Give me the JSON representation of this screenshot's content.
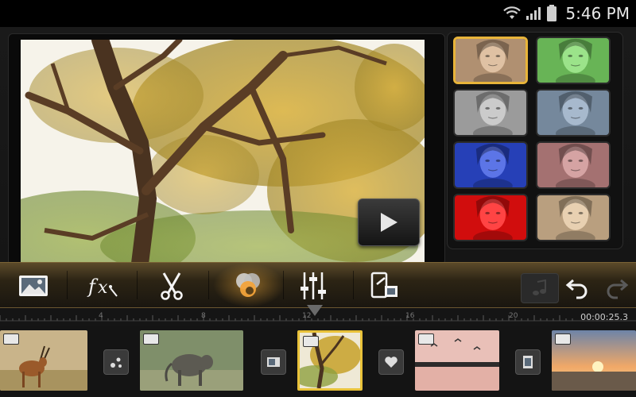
{
  "status_bar": {
    "time": "5:46 PM",
    "icons": [
      "wifi-icon",
      "signal-icon",
      "battery-icon"
    ]
  },
  "preview": {
    "play_icon": "play-icon"
  },
  "effects": {
    "thumbnails": [
      {
        "name": "original",
        "tint": "#d7b08a",
        "selected": true
      },
      {
        "name": "green",
        "tint": "#7fdc6a",
        "selected": false
      },
      {
        "name": "grayscale",
        "tint": "#bdbdbd",
        "selected": false
      },
      {
        "name": "blue-gray",
        "tint": "#8fa6bf",
        "selected": false
      },
      {
        "name": "blue",
        "tint": "#2f4fe0",
        "selected": false
      },
      {
        "name": "rose",
        "tint": "#c98a8a",
        "selected": false
      },
      {
        "name": "red",
        "tint": "#ff1010",
        "selected": false
      },
      {
        "name": "warm",
        "tint": "#e2c39b",
        "selected": false
      }
    ],
    "selected_border_color": "#e8b43a"
  },
  "toolbar": {
    "tools": [
      {
        "name": "image-tool",
        "icon": "image-icon"
      },
      {
        "name": "fx-tool",
        "icon": "fx-icon",
        "label": "fx"
      },
      {
        "name": "trim-tool",
        "icon": "scissors-icon"
      },
      {
        "name": "color-tool",
        "icon": "color-circles-icon",
        "active": true
      },
      {
        "name": "adjust-tool",
        "icon": "sliders-icon"
      },
      {
        "name": "export-tool",
        "icon": "export-device-icon"
      }
    ],
    "note_icon": "music-note-icon",
    "undo_icon": "undo-icon",
    "redo_icon": "redo-icon",
    "accent_color": "#e8b43a"
  },
  "timeline": {
    "ruler_labels": [
      "4",
      "8",
      "12",
      "16",
      "20"
    ],
    "timecode": "00:00:25.3",
    "clips": [
      {
        "name": "clip-antelope",
        "selected": false
      },
      {
        "name": "clip-baboon",
        "selected": false
      },
      {
        "name": "clip-tree",
        "selected": true
      },
      {
        "name": "clip-lake-birds",
        "selected": false
      },
      {
        "name": "clip-sunset",
        "selected": false
      }
    ],
    "transitions": [
      "sparkle-transition-icon",
      "slide-transition-icon",
      "heart-transition-icon",
      "film-transition-icon"
    ]
  }
}
